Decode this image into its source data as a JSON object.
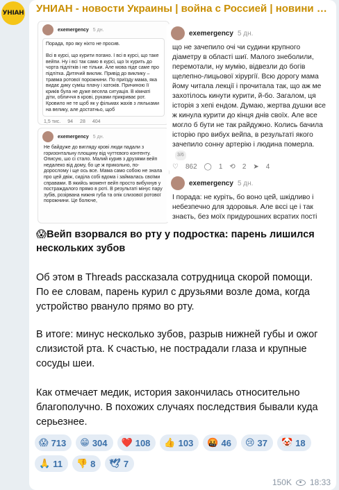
{
  "channel": {
    "avatar_label": "УНІАН",
    "title": "УНИАН - новости Украины | война с Россией | новини Украина...",
    "brand_color": "#c98e00"
  },
  "screenshots": {
    "s1": {
      "handle": "exemergency",
      "time": "5 дн.",
      "text": "Порада, про яку ніхто не просив.\n\nВсі в курсі, що курити погано. І всі в курсі, що таке вейпи. Ну і всі так само в курсі, що їх курить до чорта підлітків і не тільки. Але мова піде саме про підлітка. Дитячий виклик. Привід до виклику – травма ротової порожнини. По приїзду мама, яка видає дику суміш плачу і хатоків. Причиною її криків була не дуже весела ситуація. В кімнаті діти, обличчя в крові, руками прикриває рот. Кровило не те щоб як у фільмах жахів з ляльками на велику, але достатньо, щоб",
      "stats": [
        "1,5 тис.",
        "94",
        "28",
        "404"
      ]
    },
    "s2": {
      "handle": "exemergency",
      "time": "5 дн.",
      "text": "Не байдуже до вигляду крові люди падали з горизонтальну площину від чуттєвого контенту. Описую, шо сі стало. Малий курив з друзями вейп недалеко від дому, бо це ж прикольно, по-дорослому і ще ось все. Мама само собою не знала про цей двіж, сиділа собі вдома і займалась своїми справами. В якийсь момент вейп просто вибухнув у постраждалого прямо в роті. В результаті мінус пару зубів, розірвана нижня губа та опік слизової ротової порожнини. Це болюче,"
    },
    "s3": {
      "handle": "exemergency",
      "time": "5 дн.",
      "text": "що не зачепило очі чи судини крупного діаметру в області шиї. Малого знеболили, перемотали, ну мумію, відвезли до богів щелепно-лицьової хірургії. Всю дорогу мама йому читала лекції і прочитала так, що аж ме захотілось кинути курити, й-бо. Загалом, ця історія з хепі ендом. Думаю, жертва душки все ж кинула курити до кінця днів своїх. Але все могло б бути не так райдужно. Колись бачила історію про вибух вейпа, в результаті якого зачепило сонну артерію і людина померла.",
      "pager": "3/6",
      "stats": [
        "862",
        "1",
        "2",
        "4"
      ]
    },
    "s4": {
      "handle": "exemergency",
      "time": "5 дн.",
      "text": "І порада: не куріть, бо воно цей, шкідливо і небезпечно для здоровья. Але вєсі це і так знаєть, без моїх придурошних всратих пості"
    }
  },
  "post": {
    "headline": "😱Вейп взорвался во рту у подростка: парень лишился нескольких зубов",
    "paragraph_1": "Об этом в Threads рассказала сотрудница скорой помощи. По ее словам, парень курил с друзьями возле дома, когда устройство рванулo прямо во рту.",
    "paragraph_2": "В итоге: минус несколько зубов, разрыв нижней губы и ожог слизистой рта. К счастью, не пострадали глаза и крупные сосуды шеи.",
    "paragraph_3": "Как отмечает медик, история закончилась относительно благополучно. В похожих случаях последствия бывали куда серьезнее."
  },
  "reactions": [
    {
      "emoji": "😱",
      "count": "713",
      "color": "#f2a900"
    },
    {
      "emoji": "😁",
      "count": "304",
      "color": "#f2a900"
    },
    {
      "emoji": "❤️",
      "count": "108",
      "color": "#e53935"
    },
    {
      "emoji": "👍",
      "count": "103",
      "color": "#f2a900"
    },
    {
      "emoji": "🤬",
      "count": "46",
      "color": "#e53935"
    },
    {
      "emoji": "😢",
      "count": "37",
      "color": "#f2a900"
    },
    {
      "emoji": "🤡",
      "count": "18",
      "color": "#f2a900"
    },
    {
      "emoji": "🙏",
      "count": "11",
      "color": "#f2a900"
    },
    {
      "emoji": "👎",
      "count": "8",
      "color": "#f2a900"
    },
    {
      "emoji": "🕊",
      "count": "7",
      "color": "#9aa7b3"
    }
  ],
  "footer": {
    "views": "150K",
    "time": "18:33"
  }
}
